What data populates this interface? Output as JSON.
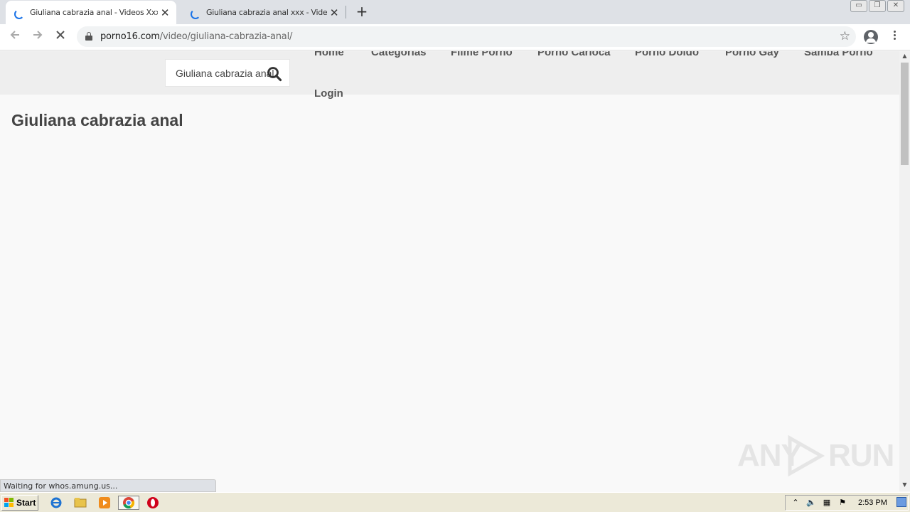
{
  "browser": {
    "tabs": [
      {
        "title": "Giuliana cabrazia anal - Videos Xxx Porno",
        "active": true
      },
      {
        "title": "Giuliana cabrazia anal xxx - Videos Xxx",
        "active": false
      }
    ],
    "new_tab_label": "+",
    "close_label": "✕",
    "window_buttons": {
      "minimize": "▭",
      "restore": "❐",
      "close": "✕"
    },
    "url_host": "porno16.com",
    "url_path": "/video/giuliana-cabrazia-anal/",
    "status_text": "Waiting for whos.amung.us..."
  },
  "site": {
    "search_value": "Giuliana cabrazia anal",
    "nav": [
      {
        "label": "Home"
      },
      {
        "label": "Categorias"
      },
      {
        "label": "Filme Porno"
      },
      {
        "label": "Porno Carioca"
      },
      {
        "label": "Porno Doido"
      },
      {
        "label": "Porno Gay"
      },
      {
        "label": "Samba Porno"
      },
      {
        "label": "Login"
      }
    ],
    "page_title": "Giuliana cabrazia anal"
  },
  "watermark": {
    "left": "ANY",
    "right": "RUN"
  },
  "taskbar": {
    "start_label": "Start",
    "clock": "2:53 PM",
    "apps": [
      {
        "icon": "internet-explorer-icon"
      },
      {
        "icon": "file-explorer-icon"
      },
      {
        "icon": "media-player-icon"
      },
      {
        "icon": "chrome-icon"
      },
      {
        "icon": "opera-icon"
      }
    ]
  },
  "colors": {
    "accent": "#1a73e8",
    "header_bg": "#eeeeee",
    "nav_text": "#555555"
  }
}
